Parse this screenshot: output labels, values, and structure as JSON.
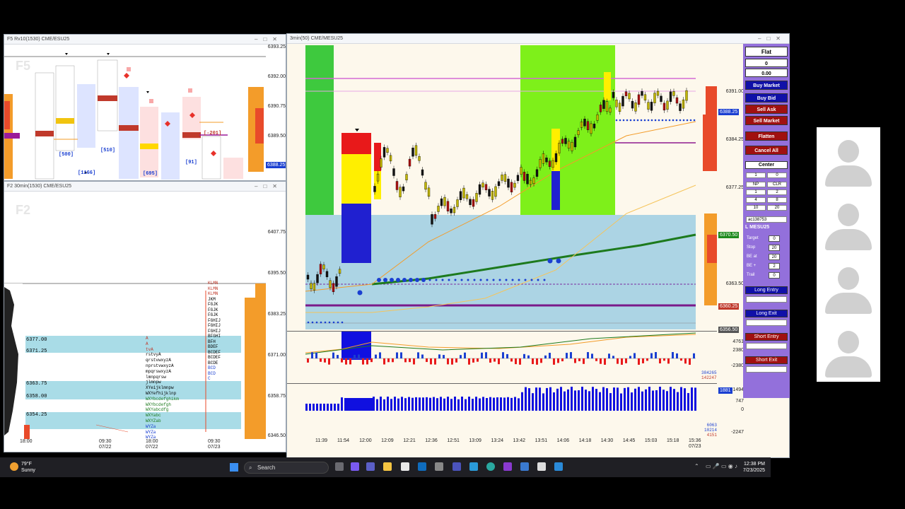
{
  "windows": {
    "f5": {
      "title": "F5 Rv10(1530) CME/ESU25",
      "watermark": "F5",
      "prices": [
        "6393.25",
        "6392.00",
        "6390.75",
        "6389.50",
        "6388.25"
      ],
      "price_tag": "6388.25",
      "footprint_totals": [
        "[500]",
        "[1166]",
        "[510]",
        "[695]",
        "[91]",
        "[-201]"
      ]
    },
    "f2": {
      "title": "F2 30min(1530) CME/ESU25",
      "watermark": "F2",
      "prices": [
        "6407.75",
        "6395.50",
        "6383.25",
        "6371.00",
        "6358.75",
        "6346.50"
      ],
      "levels": [
        "6377.00",
        "6371.25",
        "6363.75",
        "6358.00",
        "6354.25"
      ],
      "times": [
        "18:00",
        "09:30",
        "18:00",
        "09:30"
      ],
      "dates": [
        "07/22",
        "07/22",
        "07/23"
      ],
      "corner_left": "07/23 18:30",
      "corner_right": "07/23 15:30",
      "tpo_rows": [
        "KLMN",
        "KLMN",
        "KLMN",
        "JKM",
        "FGJK",
        "FGJK",
        "FGJK",
        "FGHIJ",
        "FGHIJ",
        "FGHIJ",
        "BFGHI",
        "BFH",
        "BDEF",
        "BCDEF",
        "BCDEF",
        "BCDE",
        "BCD",
        "BCD",
        "C"
      ],
      "tpo_left": [
        "A",
        "A",
        "tvA",
        "rstvyA",
        "qrstvwxyzA",
        "nprstvwxyzA",
        "mpqrswxyzA",
        "lmnpqrsw",
        "jlmnpw",
        "XYeijklmnpw",
        "WXYefhijklnp",
        "WXYbcdefghikm",
        "WXYbcdefgh",
        "WXYabcdfg",
        "WXYabc",
        "WXYZab",
        "WYZa",
        "WYZa",
        "WYZa",
        "TWa"
      ]
    },
    "main": {
      "title": "3min(50) CME/MESU25",
      "prices": [
        "6391.00",
        "6384.25",
        "6377.25",
        "6370.50",
        "6363.50"
      ],
      "tags": {
        "blue": "6388.25",
        "green": "6370.50",
        "red": "6360.25",
        "grey": "6356.50"
      },
      "times": [
        "11:39",
        "11:54",
        "12:00",
        "12:09",
        "12:21",
        "12:36",
        "12:51",
        "13:09",
        "13:24",
        "13:42",
        "13:51",
        "14:06",
        "14:18",
        "14:30",
        "14:45",
        "15:03",
        "15:18",
        "15:36"
      ],
      "date": "07/23",
      "cvd_labels": [
        "7141",
        "4761",
        "2380",
        "0",
        "-2380",
        "-4761",
        "-7142"
      ],
      "cvd_values": [
        "384265",
        "142247",
        "357861"
      ],
      "vol_labels": [
        "1494",
        "747",
        "0",
        "-747",
        "-1494",
        "-2247"
      ],
      "vol_values": [
        "6063",
        "10214",
        "4151"
      ],
      "vol_tag": "1881"
    }
  },
  "order_panel": {
    "position_label": "Flat",
    "qty": "0",
    "pnl": "0.00",
    "buttons": [
      "Buy Market",
      "Buy Bid",
      "Sell Ask",
      "Sell Market",
      "Flatten",
      "Cancel All"
    ],
    "center_label": "Center",
    "qty_cell": "1",
    "qty_right": "0",
    "grid": [
      [
        "NP",
        "CLR"
      ],
      [
        "1",
        "2"
      ],
      [
        "4",
        "8"
      ],
      [
        "10",
        "20"
      ]
    ],
    "account": "ac138753",
    "symbol": "L MESU25",
    "fields": [
      {
        "label": "Target",
        "value": "0"
      },
      {
        "label": "Stop",
        "value": "20"
      },
      {
        "label": "BE at",
        "value": "20"
      },
      {
        "label": "BE +",
        "value": "2"
      },
      {
        "label": "Trail",
        "value": "0"
      }
    ],
    "long_entry": "Long Entry",
    "long_exit": "Long Exit",
    "short_entry": "Short Entry",
    "short_exit": "Short Exit"
  },
  "taskbar": {
    "temp": "79°F",
    "weather": "Sunny",
    "search_placeholder": "Search",
    "time": "12:38 PM",
    "date": "7/23/2025"
  }
}
